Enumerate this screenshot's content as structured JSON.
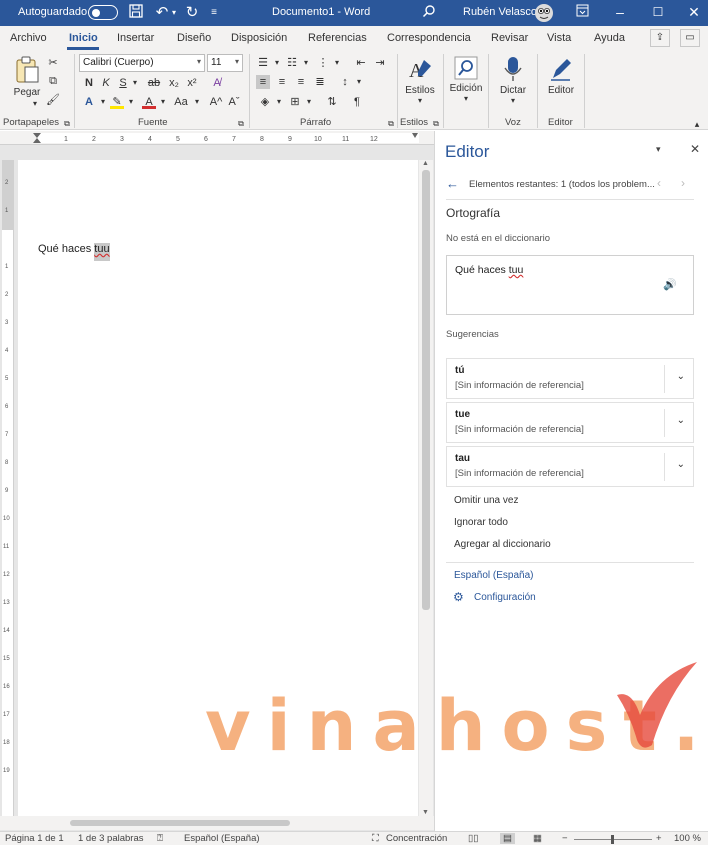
{
  "titlebar": {
    "autosave_label": "Autoguardado",
    "document_title": "Documento1 - Word",
    "user_name": "Rubén Velasco",
    "accent_color": "#2b579a"
  },
  "tabs": [
    "Archivo",
    "Inicio",
    "Insertar",
    "Diseño",
    "Disposición",
    "Referencias",
    "Correspondencia",
    "Revisar",
    "Vista",
    "Ayuda"
  ],
  "active_tab": "Inicio",
  "ribbon": {
    "clipboard": {
      "paste_label": "Pegar",
      "group_label": "Portapapeles"
    },
    "font": {
      "font_name": "Calibri (Cuerpo)",
      "font_size": "11",
      "group_label": "Fuente",
      "bold": "N",
      "italic": "K",
      "underline": "S",
      "strike": "ab",
      "subscript": "x₂",
      "superscript": "x²",
      "font_color_letter": "A",
      "change_case": "Aa",
      "grow": "A^",
      "shrink": "Aˇ"
    },
    "paragraph": {
      "group_label": "Párrafo"
    },
    "styles": {
      "button_label": "Estilos",
      "group_label": "Estilos"
    },
    "editing": {
      "button_label": "Edición"
    },
    "voice": {
      "button_label": "Dictar",
      "group_label": "Voz"
    },
    "editor": {
      "button_label": "Editor",
      "group_label": "Editor"
    }
  },
  "document": {
    "text_before": "Qué haces ",
    "misspelled_word": "tuu"
  },
  "editor_pane": {
    "title": "Editor",
    "nav_text": "Elementos restantes: 1 (todos los problem...",
    "section_title": "Ortografía",
    "subtitle": "No está en el diccionario",
    "context_before": "Qué haces ",
    "context_word": "tuu",
    "suggestions_label": "Sugerencias",
    "suggestions": [
      {
        "word": "tú",
        "ref": "[Sin información de referencia]"
      },
      {
        "word": "tue",
        "ref": "[Sin información de referencia]"
      },
      {
        "word": "tau",
        "ref": "[Sin información de referencia]"
      }
    ],
    "actions": [
      "Omitir una vez",
      "Ignorar todo",
      "Agregar al diccionario"
    ],
    "language": "Español (España)",
    "settings": "Configuración"
  },
  "statusbar": {
    "page": "Página 1 de 1",
    "words": "1 de 3 palabras",
    "language": "Español (España)",
    "focus": "Concentración",
    "zoom": "100 %"
  },
  "watermark": "vinahost."
}
